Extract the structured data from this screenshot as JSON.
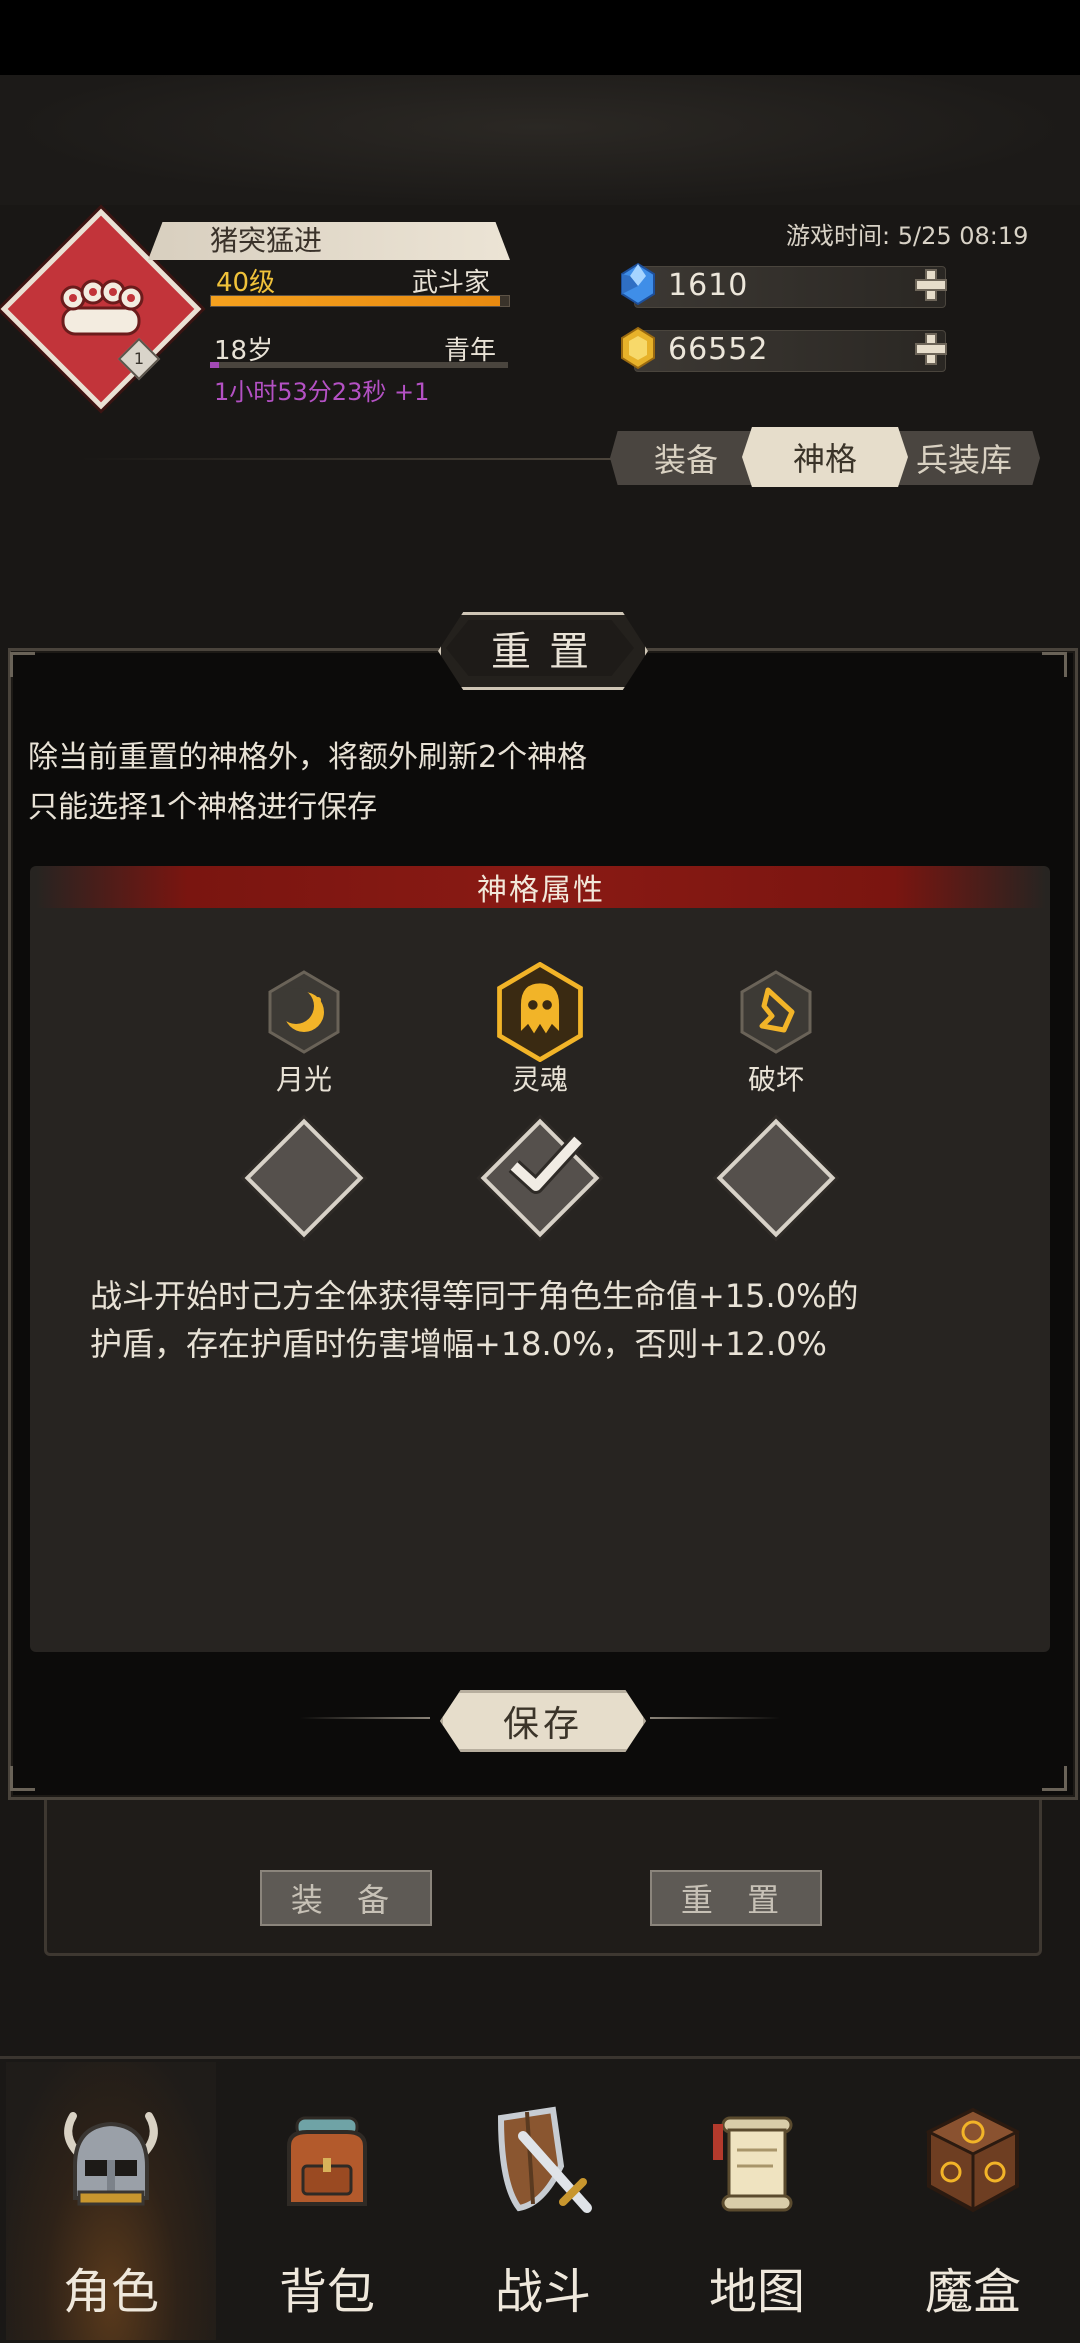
{
  "header": {
    "character_name": "猪突猛进",
    "level": "40级",
    "job": "武斗家",
    "exp_progress": 0.97,
    "age": "18岁",
    "life_stage": "青年",
    "age_progress": 0.03,
    "timer": "1小时53分23秒 +1",
    "badge_level": "1",
    "game_time": "游戏时间: 5/25 08:19",
    "diamonds": "1610",
    "gold": "66552"
  },
  "tabs": [
    {
      "label": "装备",
      "active": false
    },
    {
      "label": "神格",
      "active": true
    },
    {
      "label": "兵装库",
      "active": false
    }
  ],
  "background_buttons": {
    "equip": "装 备",
    "reset": "重 置"
  },
  "dialog": {
    "title": "重置",
    "desc_line1": "除当前重置的神格外，将额外刷新2个神格",
    "desc_line2": "只能选择1个神格进行保存",
    "section_title": "神格属性",
    "options": [
      {
        "label": "月光",
        "icon": "moon-icon",
        "selected": false
      },
      {
        "label": "灵魂",
        "icon": "soul-icon",
        "selected": true
      },
      {
        "label": "破坏",
        "icon": "destroy-icon",
        "selected": false
      }
    ],
    "effect_line1": "战斗开始时己方全体获得等同于角色生命值+15.0%的",
    "effect_line2": "护盾，存在护盾时伤害增幅+18.0%，否则+12.0%",
    "save_label": "保存"
  },
  "nav": [
    {
      "label": "角色",
      "icon": "helmet-icon",
      "active": true
    },
    {
      "label": "背包",
      "icon": "backpack-icon",
      "active": false
    },
    {
      "label": "战斗",
      "icon": "sword-shield-icon",
      "active": false
    },
    {
      "label": "地图",
      "icon": "scroll-map-icon",
      "active": false
    },
    {
      "label": "魔盒",
      "icon": "magic-box-icon",
      "active": false
    }
  ],
  "colors": {
    "accent_gold": "#f0c23a",
    "exp_orange": "#f4a11e",
    "timer_purple": "#b451c4",
    "section_red": "#8a1a14",
    "badge_red": "#c2343a"
  }
}
